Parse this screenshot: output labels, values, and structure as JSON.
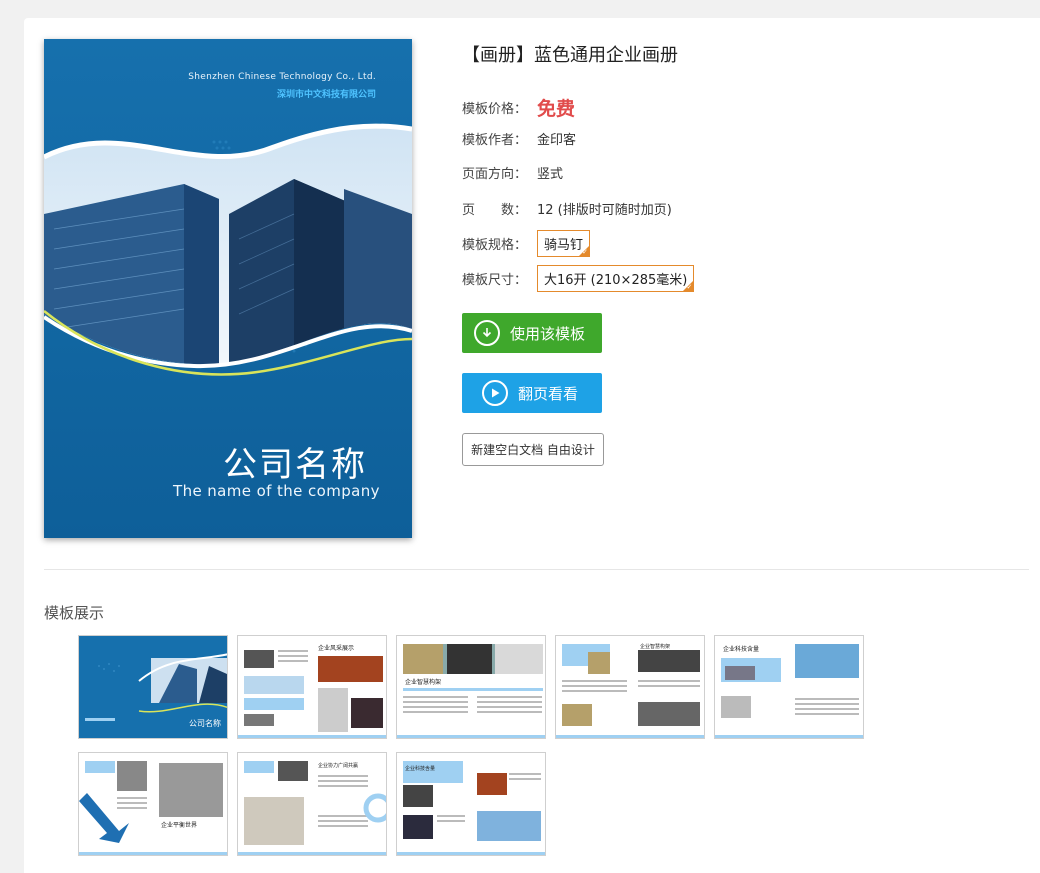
{
  "cover": {
    "company_en": "Shenzhen Chinese Technology Co., Ltd.",
    "company_cn": "深圳市中文科技有限公司",
    "title": "公司名称",
    "subtitle": "The name of the company"
  },
  "product": {
    "title": "【画册】蓝色通用企业画册",
    "price_label": "模板价格：",
    "price": "免费",
    "author_label": "模板作者：",
    "author": "金印客",
    "orientation_label": "页面方向：",
    "orientation": "竖式",
    "pages_label": "页　　数：",
    "pages": "12 (排版时可随时加页)",
    "spec_label": "模板规格：",
    "spec": "骑马钉",
    "size_label": "模板尺寸：",
    "size": "大16开 (210×285毫米)"
  },
  "actions": {
    "use_template": "使用该模板",
    "flip_view": "翻页看看",
    "new_blank": "新建空白文档 自由设计"
  },
  "showcase": {
    "title": "模板展示",
    "thumbnails": [
      {
        "heading": "公司名称"
      },
      {
        "heading": "企业风采展示"
      },
      {
        "heading": "企业智慧构架"
      },
      {
        "heading": "企业智慧构架"
      },
      {
        "heading": "企业科技含量"
      },
      {
        "heading": "企业平衡世界"
      },
      {
        "heading": "企业协力广阔共赢"
      },
      {
        "heading": "企业科技含量"
      }
    ]
  },
  "colors": {
    "accent_green": "#3fa82c",
    "accent_blue": "#1ea2e6",
    "price_red": "#e14b4b",
    "tag_orange": "#e48a2c",
    "cover_blue": "#1670ad"
  }
}
